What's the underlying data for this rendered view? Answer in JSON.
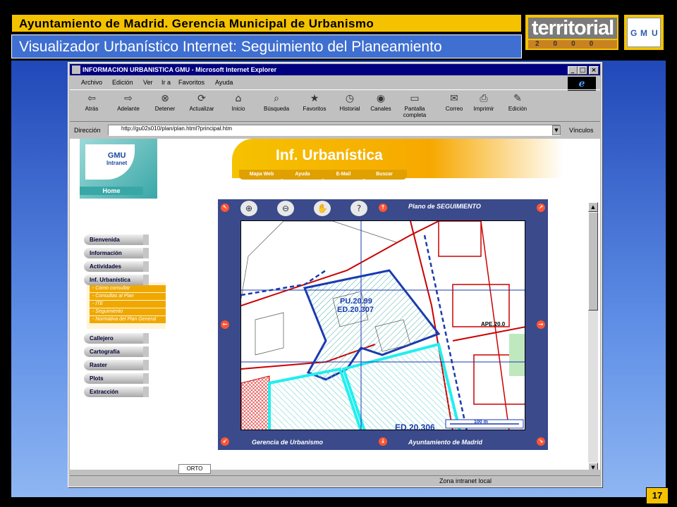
{
  "slide": {
    "title": "Ayuntamiento de Madrid. Gerencia Municipal de Urbanismo",
    "subtitle": "Visualizador Urbanístico Internet: Seguimiento del Planeamiento",
    "logo_territorial": "territorial",
    "logo_territorial_year": "2000",
    "logo_gmu": [
      "G",
      "M",
      "U"
    ],
    "page_number": "17"
  },
  "browser": {
    "title": "INFORMACION URBANISTICA GMU - Microsoft Internet Explorer",
    "menu": [
      "Archivo",
      "Edición",
      "Ver",
      "Ir a",
      "Favoritos",
      "Ayuda"
    ],
    "toolbar": [
      {
        "label": "Atrás",
        "icon": "back-arrow-icon",
        "glyph": "⇦"
      },
      {
        "label": "Adelante",
        "icon": "forward-arrow-icon",
        "glyph": "⇨"
      },
      {
        "label": "Detener",
        "icon": "stop-icon",
        "glyph": "⊗"
      },
      {
        "label": "Actualizar",
        "icon": "refresh-icon",
        "glyph": "⟳"
      },
      {
        "label": "Inicio",
        "icon": "home-icon",
        "glyph": "⌂"
      },
      {
        "label": "Búsqueda",
        "icon": "search-icon",
        "glyph": "⌕"
      },
      {
        "label": "Favoritos",
        "icon": "favorites-icon",
        "glyph": "★"
      },
      {
        "label": "Historial",
        "icon": "history-icon",
        "glyph": "◷"
      },
      {
        "label": "Canales",
        "icon": "channels-icon",
        "glyph": "◉"
      },
      {
        "label": "Pantalla completa",
        "icon": "fullscreen-icon",
        "glyph": "▭"
      },
      {
        "label": "Correo",
        "icon": "mail-icon",
        "glyph": "✉"
      },
      {
        "label": "Imprimir",
        "icon": "print-icon",
        "glyph": "⎙"
      },
      {
        "label": "Edición",
        "icon": "edit-icon",
        "glyph": "✎"
      }
    ],
    "address_label": "Dirección",
    "address_value": "http://gu02s010/plan/plan.html?principal.htm",
    "links_label": "Vínculos",
    "status_zone": "Zona intranet local",
    "tab_label": "ORTO"
  },
  "page": {
    "gmu_logo": "GMU",
    "gmu_sub": "Intranet",
    "home_label": "Home",
    "banner_title": "Inf. Urbanística",
    "banner_tabs": [
      "Mapa Web",
      "Ayuda",
      "E-Mail",
      "Buscar"
    ],
    "nav_top": [
      "Bienvenida",
      "Información",
      "Actividades",
      "Inf. Urbanística"
    ],
    "sub_items": [
      "- Cómo consultar",
      "- Consultas al Plan",
      "- ITE",
      "- Seguimiento",
      "- Normativa del Plan General"
    ],
    "nav_bottom": [
      "Callejero",
      "Cartografía",
      "Raster",
      "Plots",
      "Extracción"
    ],
    "map": {
      "header": "Plano de SEGUIMIENTO",
      "footer_left": "Gerencia de Urbanismo",
      "footer_right": "Ayuntamiento de Madrid",
      "label_pu": "PU.20.99",
      "label_ed1": "ED.20.307",
      "label_ed2": "ED.20.306",
      "label_ape": "APE.20.0",
      "scale": "100 m"
    }
  }
}
